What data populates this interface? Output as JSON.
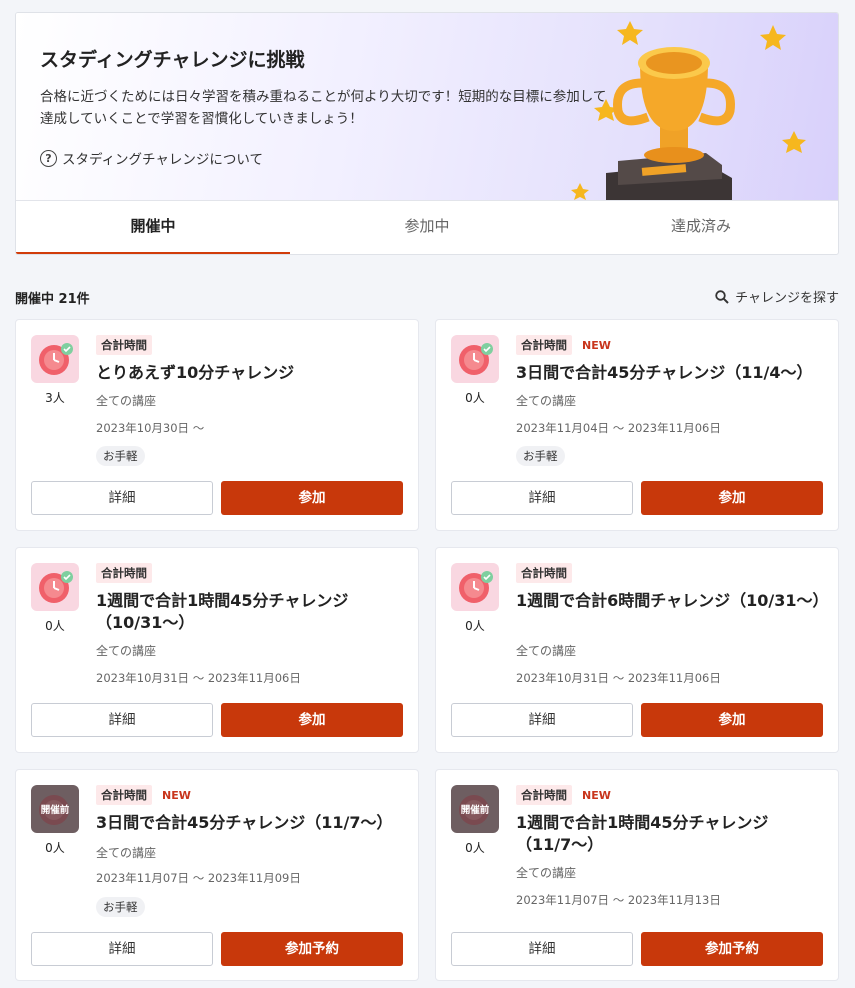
{
  "hero": {
    "title": "スタディングチャレンジに挑戦",
    "desc": "合格に近づくためには日々学習を積み重ねることが何より大切です！短期的な目標に参加して達成していくことで学習を習慣化していきましょう！",
    "link": "スタディングチャレンジについて"
  },
  "tabs": [
    "開催中",
    "参加中",
    "達成済み"
  ],
  "list": {
    "count": "開催中 21件",
    "search": "チャレンジを探す"
  },
  "cards": [
    {
      "tag": "合計時間",
      "new": "",
      "title": "とりあえず10分チャレンジ",
      "course": "全ての講座",
      "dates": "2023年10月30日 〜",
      "badge": "お手軽",
      "people": "3人",
      "detail": "詳細",
      "join": "参加"
    },
    {
      "tag": "合計時間",
      "new": "NEW",
      "title": "3日間で合計45分チャレンジ（11/4〜）",
      "course": "全ての講座",
      "dates": "2023年11月04日 〜 2023年11月06日",
      "badge": "お手軽",
      "people": "0人",
      "detail": "詳細",
      "join": "参加"
    },
    {
      "tag": "合計時間",
      "new": "",
      "title": "1週間で合計1時間45分チャレンジ（10/31〜）",
      "course": "全ての講座",
      "dates": "2023年10月31日 〜 2023年11月06日",
      "badge": "",
      "people": "0人",
      "detail": "詳細",
      "join": "参加"
    },
    {
      "tag": "合計時間",
      "new": "",
      "title": "1週間で合計6時間チャレンジ（10/31〜）",
      "course": "全ての講座",
      "dates": "2023年10月31日 〜 2023年11月06日",
      "badge": "",
      "people": "0人",
      "detail": "詳細",
      "join": "参加"
    },
    {
      "tag": "合計時間",
      "new": "NEW",
      "title": "3日間で合計45分チャレンジ（11/7〜）",
      "course": "全ての講座",
      "dates": "2023年11月07日 〜 2023年11月09日",
      "badge": "お手軽",
      "people": "0人",
      "thumb_label": "開催前",
      "detail": "詳細",
      "join": "参加予約"
    },
    {
      "tag": "合計時間",
      "new": "NEW",
      "title": "1週間で合計1時間45分チャレンジ（11/7〜）",
      "course": "全ての講座",
      "dates": "2023年11月07日 〜 2023年11月13日",
      "badge": "",
      "people": "0人",
      "thumb_label": "開催前",
      "detail": "詳細",
      "join": "参加予約"
    }
  ],
  "colors": {
    "accent": "#c8380b",
    "tag_bg": "#fde9ea",
    "new": "#c8351c"
  }
}
